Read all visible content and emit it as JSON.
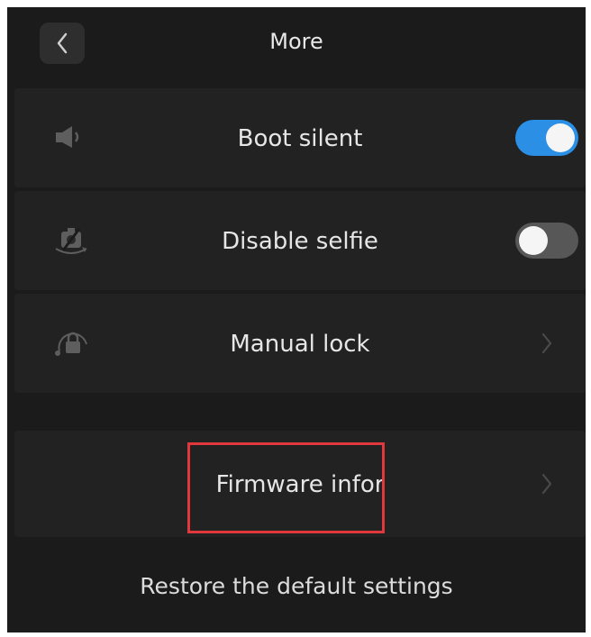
{
  "header": {
    "title": "More",
    "back_icon": "chevron-left-icon"
  },
  "settings": [
    {
      "label": "Boot silent",
      "icon": "speaker-icon",
      "control": "toggle",
      "enabled": true
    },
    {
      "label": "Disable selfie",
      "icon": "camera-off-icon",
      "control": "toggle",
      "enabled": false
    },
    {
      "label": "Manual lock",
      "icon": "lock-icon",
      "control": "chevron"
    }
  ],
  "firmware": {
    "label": "Firmware infor",
    "control": "chevron"
  },
  "restore": {
    "label": "Restore the default settings"
  },
  "colors": {
    "background": "#1b1b1b",
    "row_background": "#222222",
    "toggle_on": "#2b8fe6",
    "toggle_off": "#575757",
    "highlight": "#e0383c"
  }
}
